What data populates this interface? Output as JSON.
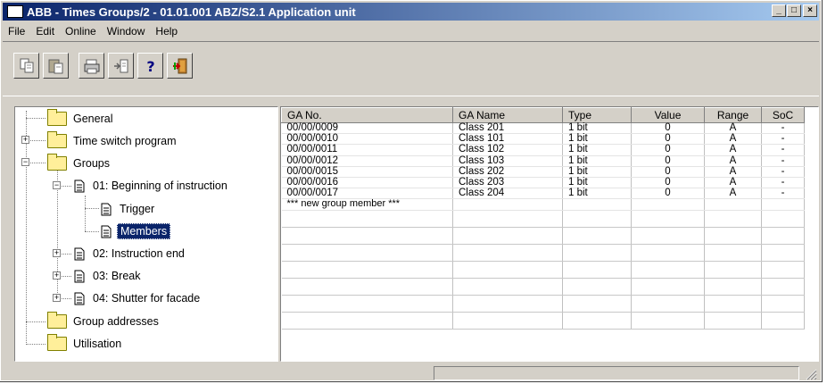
{
  "window": {
    "title": "ABB - Times Groups/2 - 01.01.001 ABZ/S2.1 Application unit",
    "minimize": "_",
    "maximize": "□",
    "close": "×"
  },
  "menu": {
    "items": [
      "File",
      "Edit",
      "Online",
      "Window",
      "Help"
    ]
  },
  "toolbar": {
    "buttons": [
      "copy-icon",
      "paste-icon",
      "print-icon",
      "import-icon",
      "help-icon",
      "exit-icon"
    ]
  },
  "tree": {
    "general": "General",
    "time_switch": "Time switch program",
    "groups": "Groups",
    "g01": "01: Beginning of instruction",
    "trigger": "Trigger",
    "members": "Members",
    "g02": "02: Instruction end",
    "g03": "03: Break",
    "g04": "04: Shutter for facade",
    "group_addresses": "Group addresses",
    "utilisation": "Utilisation"
  },
  "table": {
    "headers": [
      "GA No.",
      "GA Name",
      "Type",
      "Value",
      "Range",
      "SoC"
    ],
    "rows": [
      [
        "00/00/0009",
        "Class 201",
        "1 bit",
        "0",
        "A",
        "-"
      ],
      [
        "00/00/0010",
        "Class 101",
        "1 bit",
        "0",
        "A",
        "-"
      ],
      [
        "00/00/0011",
        "Class 102",
        "1 bit",
        "0",
        "A",
        "-"
      ],
      [
        "00/00/0012",
        "Class 103",
        "1 bit",
        "0",
        "A",
        "-"
      ],
      [
        "00/00/0015",
        "Class 202",
        "1 bit",
        "0",
        "A",
        "-"
      ],
      [
        "00/00/0016",
        "Class 203",
        "1 bit",
        "0",
        "A",
        "-"
      ],
      [
        "00/00/0017",
        "Class 204",
        "1 bit",
        "0",
        "A",
        "-"
      ]
    ],
    "new_member": "*** new group member ***"
  },
  "colors": {
    "title_active": "#0a246a",
    "face": "#d4d0c8",
    "selection": "#0a246a"
  }
}
